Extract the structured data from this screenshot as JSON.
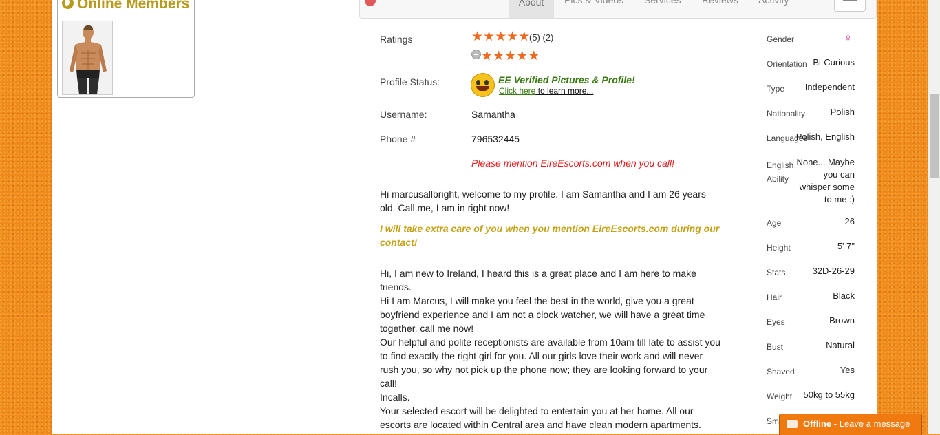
{
  "online_members": {
    "title": "Online Members"
  },
  "tabs": [
    {
      "label": "About"
    },
    {
      "label": "Pics & Videos"
    },
    {
      "label": "Services"
    },
    {
      "label": "Reviews"
    },
    {
      "label": "Activity"
    }
  ],
  "profile": {
    "ratings_label": "Ratings",
    "rating_stars": 5,
    "rating_count": "(5) (2)",
    "status_label": "Profile Status:",
    "verified_text": "EE Verified Pictures & Profile!",
    "click_here": "Click here",
    "learn_more": " to learn more...",
    "username_label": "Username:",
    "username": "Samantha",
    "phone_label": "Phone #",
    "phone": "796532445",
    "mention": "Please mention EireEscorts.com when you call!"
  },
  "bio": {
    "welcome": "Hi marcusallbright, welcome to my profile. I am Samantha and I am 26 years old. Call me, I am in right now!",
    "promo": "I will take extra care of you when you mention EireEscorts.com during our contact!",
    "body_1": "Hi, I am new to Ireland, I heard this is a great place and I am here to make friends.",
    "body_2": "Hi I am Marcus, I will make you feel the best in the world, give you a great boyfriend experience and I am not a clock watcher, we will have a great time together, call me now!",
    "body_3": "Our helpful and polite receptionists are available from 10am till late to assist you to find exactly the right girl for you. All our girls love their work and will never rush you, so why not pick up the phone now; they are looking forward to your call!",
    "body_4": "Incalls.",
    "body_5": "Your selected escort will be delighted to entertain you at her home. All our escorts are located within Central area and have clean modern apartments."
  },
  "attributes": {
    "gender_label": "Gender",
    "gender_icon": "female-symbol-icon",
    "orientation_label": "Orientation",
    "orientation": "Bi-Curious",
    "type_label": "Type",
    "type": "Independent",
    "nationality_label": "Nationality",
    "nationality": "Polish",
    "languages_label": "Languages",
    "languages": "Polish, English",
    "english_label": "English Ability",
    "english": "None... Maybe you can whisper some to me :)",
    "age_label": "Age",
    "age": "26",
    "height_label": "Height",
    "height": "5' 7\"",
    "stats_label": "Stats",
    "stats": "32D-26-29",
    "hair_label": "Hair",
    "hair": "Black",
    "eyes_label": "Eyes",
    "eyes": "Brown",
    "bust_label": "Bust",
    "bust": "Natural",
    "shaved_label": "Shaved",
    "shaved": "Yes",
    "weight_label": "Weight",
    "weight": "50kg to 55kg",
    "smoker_label": "Sm"
  },
  "chat": {
    "status": "Offline",
    "action": " - Leave a message"
  },
  "colors": {
    "background": "#f08a1c",
    "accent_gold": "#c4a21a",
    "star": "#ee6a1f",
    "mention_red": "#e02020",
    "verified_green": "#3a7a12",
    "chat_orange": "#f07a10"
  }
}
